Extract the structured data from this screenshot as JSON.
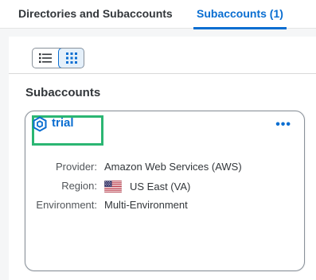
{
  "tabs": [
    {
      "label": "Directories and Subaccounts",
      "active": false
    },
    {
      "label": "Subaccounts (1)",
      "active": true
    }
  ],
  "view_toggle": {
    "selected": "grid",
    "options": [
      "list",
      "grid"
    ]
  },
  "section": {
    "title": "Subaccounts"
  },
  "card": {
    "title": "trial",
    "more_label": "•••",
    "properties": [
      {
        "label": "Provider:",
        "value": "Amazon Web Services (AWS)"
      },
      {
        "label": "Region:",
        "value": "US East (VA)",
        "flag": "us-flag-icon"
      },
      {
        "label": "Environment:",
        "value": "Multi-Environment"
      }
    ]
  },
  "colors": {
    "accent": "#0a6ed1",
    "highlight": "#2bb673",
    "text": "#32363a"
  }
}
